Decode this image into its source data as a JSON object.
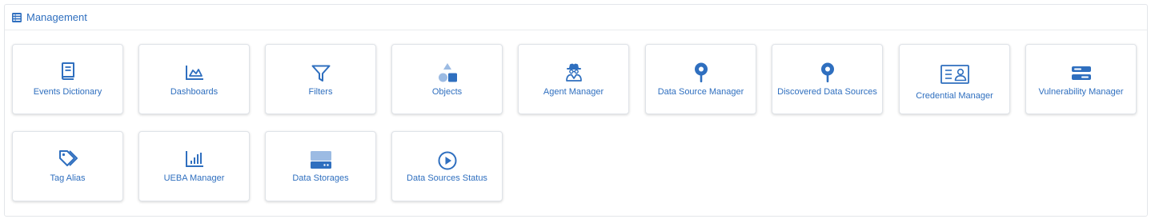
{
  "panel": {
    "title": "Management",
    "header_icon": "table-list-icon"
  },
  "accent_color": "#2f6fbf",
  "tiles": [
    {
      "label": "Events Dictionary",
      "icon": "book-icon"
    },
    {
      "label": "Dashboards",
      "icon": "area-chart-icon"
    },
    {
      "label": "Filters",
      "icon": "filter-icon"
    },
    {
      "label": "Objects",
      "icon": "shapes-icon"
    },
    {
      "label": "Agent Manager",
      "icon": "user-secret-icon"
    },
    {
      "label": "Data Source Manager",
      "icon": "map-pin-icon"
    },
    {
      "label": "Discovered Data Sources",
      "icon": "map-pin-icon"
    },
    {
      "label": "Credential Manager",
      "icon": "id-card-icon"
    },
    {
      "label": "Vulnerability Manager",
      "icon": "toggle-icon"
    },
    {
      "label": "Tag Alias",
      "icon": "tags-icon"
    },
    {
      "label": "UEBA Manager",
      "icon": "bar-chart-icon"
    },
    {
      "label": "Data Storages",
      "icon": "hard-drive-icon"
    },
    {
      "label": "Data Sources Status",
      "icon": "play-circle-icon"
    }
  ]
}
